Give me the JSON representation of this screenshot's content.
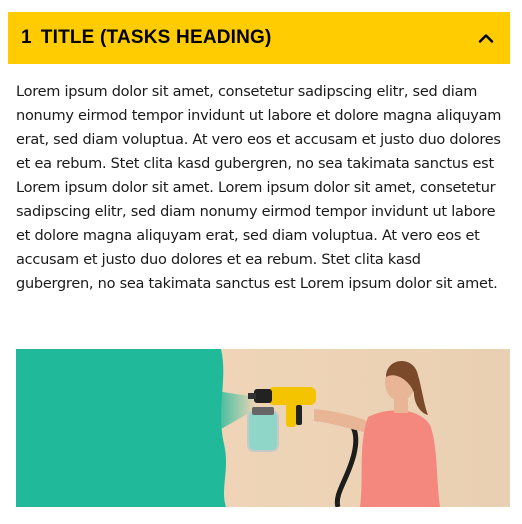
{
  "accordion": {
    "number": "1",
    "title": "TITLE (TASKS HEADING)",
    "toggle_icon": "chevron-up-icon",
    "body_text": "Lorem ipsum dolor sit amet, consetetur sadipscing elitr, sed diam nonumy eirmod tempor invidunt ut labore et dolore magna aliquyam erat, sed diam voluptua. At vero eos et accusam et justo duo dolores et ea rebum. Stet clita kasd gubergren, no sea takimata sanctus est Lorem ipsum dolor sit amet. Lorem ipsum dolor sit amet, consetetur sadipscing elitr, sed diam nonumy eirmod tempor invidunt ut labore et dolore magna aliquyam erat, sed diam voluptua. At vero eos et accusam et justo duo dolores et ea rebum. Stet clita kasd gubergren, no sea takimata sanctus est Lorem ipsum dolor sit amet.",
    "image": {
      "subject": "woman-spray-painting-wall-photo",
      "colors": {
        "header_bg": "#fecc00",
        "paint_teal": "#20b99a",
        "wall_beige": "#f0d2b2",
        "shirt_coral": "#f4877e",
        "tool_yellow": "#f5c400"
      }
    }
  }
}
